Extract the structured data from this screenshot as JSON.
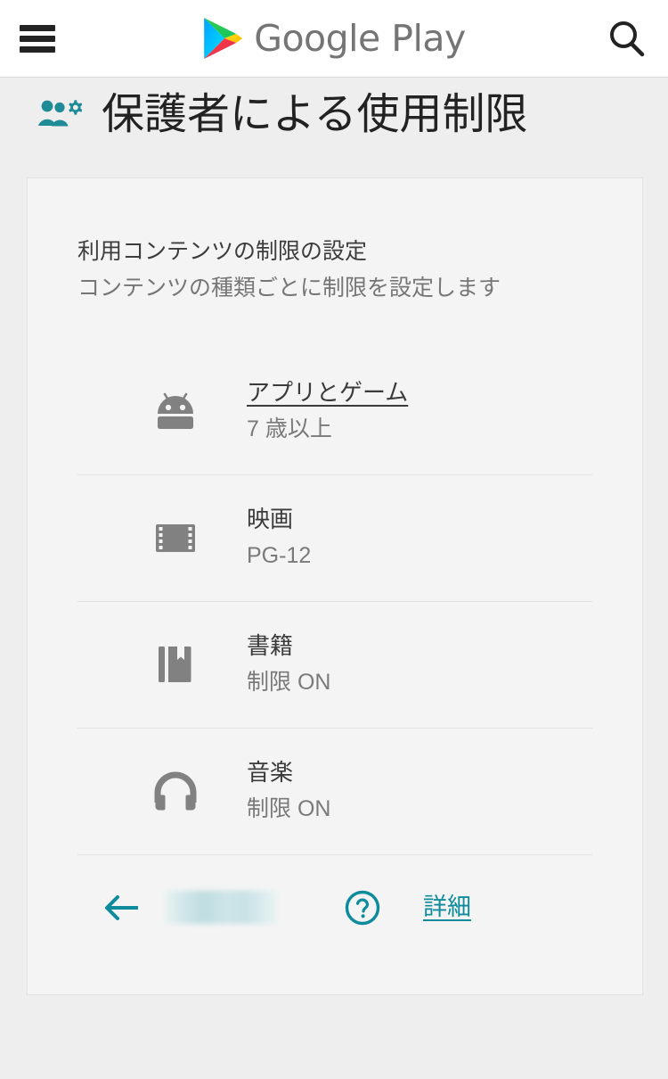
{
  "appbar": {
    "menu_icon": "hamburger-menu-icon",
    "brand_name": "Google Play",
    "search_icon": "search-icon",
    "logo_colors": {
      "blue": "#00c3ff",
      "green": "#2ed04b",
      "yellow": "#ffd500",
      "red": "#f4402d"
    }
  },
  "page": {
    "icon": "parental-controls-icon",
    "title": "保護者による使用制限",
    "accent_color": "#0e8b9c",
    "background_color": "#eeeeee",
    "card_background_color": "#f4f4f4"
  },
  "card": {
    "title": "利用コンテンツの制限の設定",
    "subtitle": "コンテンツの種類ごとに制限を設定します",
    "rows": [
      {
        "icon": "android-robot-icon",
        "label": "アプリとゲーム",
        "value": "7 歳以上",
        "is_link": true
      },
      {
        "icon": "film-strip-icon",
        "label": "映画",
        "value": "PG-12",
        "is_link": false
      },
      {
        "icon": "book-icon",
        "label": "書籍",
        "value": "制限 ON",
        "is_link": false
      },
      {
        "icon": "headphones-icon",
        "label": "音楽",
        "value": "制限 ON",
        "is_link": false
      }
    ],
    "footer": {
      "back_icon": "back-arrow-icon",
      "redacted_field": "",
      "help_icon": "help-circle-icon",
      "details_label": "詳細"
    }
  }
}
